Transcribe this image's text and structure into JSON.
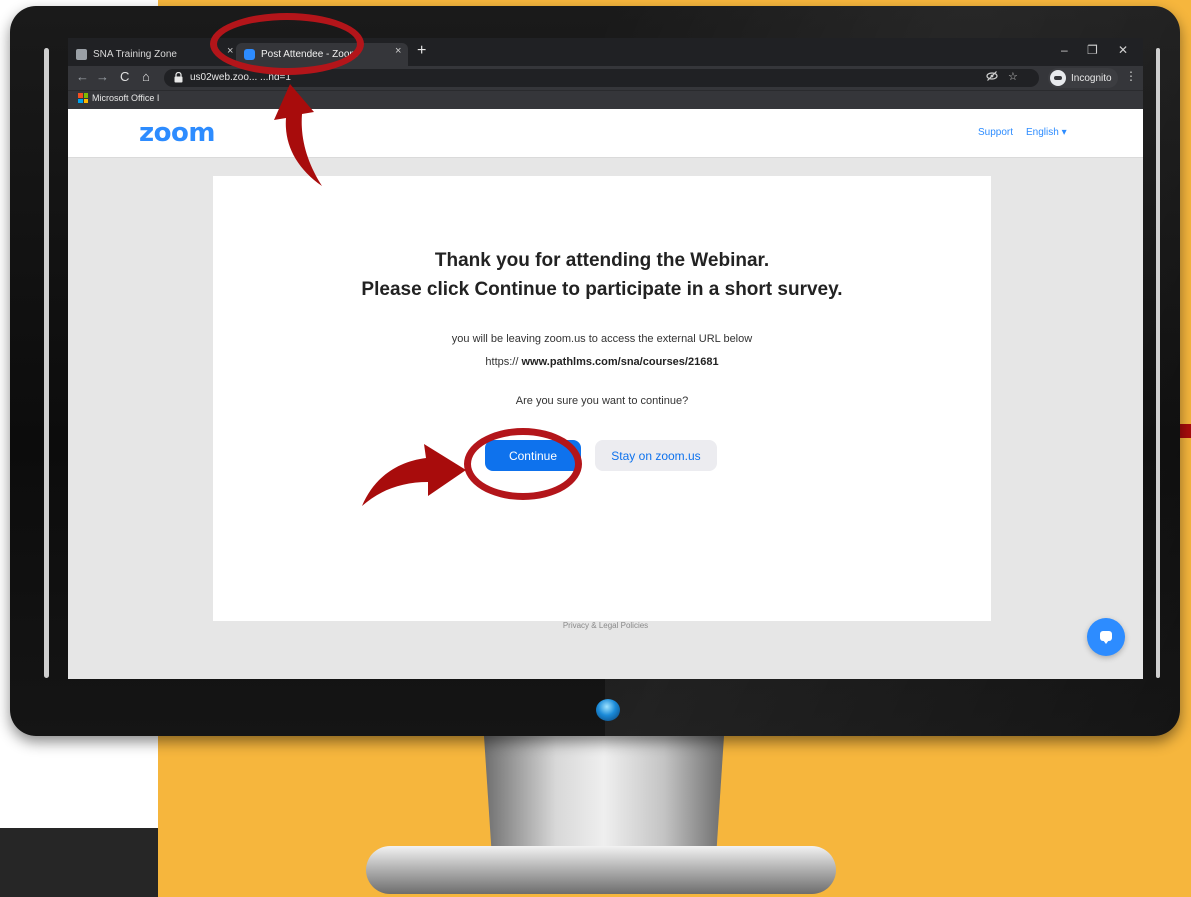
{
  "browser": {
    "tabs": [
      {
        "label": "SNA Training Zone",
        "active": false
      },
      {
        "label": "Post Attendee - Zoom",
        "active": true
      }
    ],
    "new_tab_symbol": "+",
    "close_symbol": "×",
    "window_controls": {
      "minimize": "–",
      "maximize": "❐",
      "close": "✕"
    },
    "nav": {
      "back": "←",
      "forward": "→",
      "reload": "C",
      "home": "⌂"
    },
    "url_visible_text": "us02web.zoo...  ...nd=1",
    "incognito_label": "Incognito",
    "bookmark_label": "Microsoft Office I",
    "icons": [
      "lock-icon",
      "eye-off-icon",
      "star-icon",
      "incognito-icon",
      "kebab-menu-icon"
    ]
  },
  "zoom_page": {
    "logo": "zoom",
    "support_label": "Support",
    "language_label": "English ▾",
    "heading_line1": "Thank you for attending the Webinar.",
    "heading_line2": "Please click Continue to participate in a short survey.",
    "leaving_text": "you will be leaving zoom.us to access the external URL below",
    "url_prefix": "https://",
    "url_value": "www.pathlms.com/sna/courses/21681",
    "confirm_text": "Are you sure you want to continue?",
    "continue_label": "Continue",
    "stay_label": "Stay on zoom.us",
    "privacy_label": "Privacy & Legal Policies"
  },
  "colors": {
    "background_yellow": "#f6b63d",
    "annotation_red": "#b3151a",
    "zoom_blue": "#0e72ed"
  }
}
